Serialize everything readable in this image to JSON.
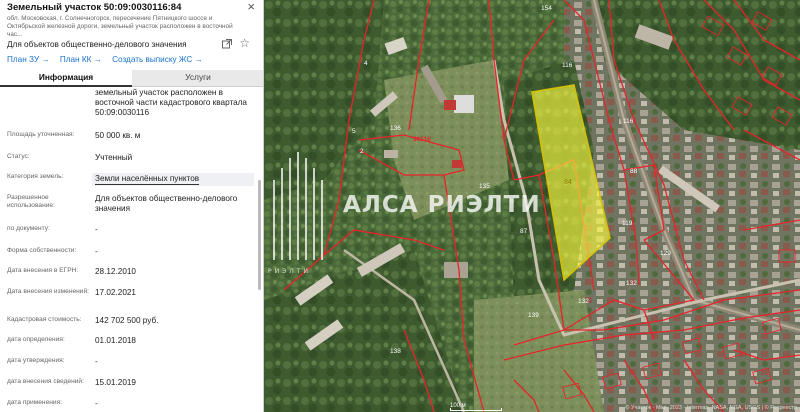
{
  "panel": {
    "title": "Земельный участок 50:09:0030116:84",
    "address": "обл. Московская, г. Солнечногорск, пересечение Пятницкого шоссе и Октябрьской железной дороги, земельный участок расположен в восточной час...",
    "purpose": "Для объектов общественно-делового значения",
    "links": [
      "План ЗУ →",
      "План КК →",
      "Создать выписку ЖС →"
    ],
    "tabs": [
      "Информация",
      "Услуги"
    ],
    "description": "земельный участок расположен в восточной части кадастрового квартала 50:09:0030116",
    "rows": [
      {
        "label": "Площадь уточненная:",
        "value": "50 000 кв. м"
      },
      {
        "label": "Статус:",
        "value": "Учтенный"
      },
      {
        "label": "Категория земель:",
        "value": "Земли населённых пунктов"
      },
      {
        "label": "Разрешенное использование:",
        "value": "Для объектов общественно-делового значения"
      },
      {
        "label": "по документу:",
        "value": "-"
      },
      {
        "label": "Форма собственности:",
        "value": "-"
      },
      {
        "label": "Дата внесения в ЕГРН:",
        "value": "28.12.2010"
      },
      {
        "label": "Дата внесения изменений:",
        "value": "17.02.2021"
      },
      {
        "label": "Кадастровая стоимость:",
        "value": "142 702 500 руб."
      },
      {
        "label": "дата определения:",
        "value": "01.01.2018"
      },
      {
        "label": "дата утверждения:",
        "value": "-"
      },
      {
        "label": "дата внесения сведений:",
        "value": "15.01.2019"
      },
      {
        "label": "дата применения:",
        "value": "-"
      }
    ]
  },
  "map": {
    "parcel_label": "84",
    "labels": [
      "154",
      "116",
      "116",
      "136",
      "135",
      "87",
      "88",
      "119",
      "129",
      "132",
      "132",
      "139",
      "138",
      "4",
      "2",
      "5",
      "30116"
    ],
    "scale": "100 м",
    "attribution": "© Участок · Map. 2023 · Intermap, NASA, NGA, USGS | © Росреестр",
    "colors": {
      "boundary": "#e8232a",
      "parcel_fill": "#ffff40",
      "parcel_stroke": "#d8c000"
    }
  },
  "watermark": {
    "brand": "АЛСА РИЭЛТИ",
    "sub": "РИЭЛТИ"
  }
}
